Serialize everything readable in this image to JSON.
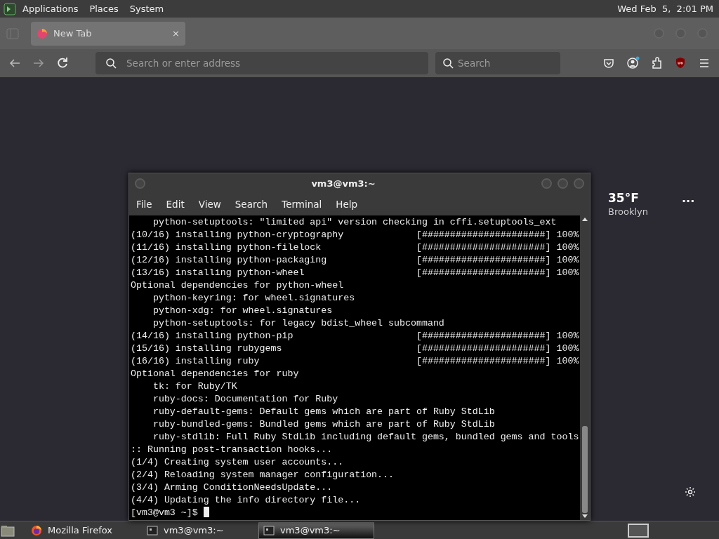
{
  "top_panel": {
    "menus": [
      "Applications",
      "Places",
      "System"
    ],
    "clock": "Wed Feb  5,  2:01 PM"
  },
  "browser": {
    "tabs": [
      {
        "label": "New Tab",
        "close": "×",
        "selected": true
      }
    ],
    "address_bar": {
      "placeholder": "Search or enter address"
    },
    "search_bar": {
      "placeholder": "Search"
    },
    "weather": {
      "temperature": "35°F",
      "city": "Brooklyn",
      "more": "···"
    }
  },
  "terminal": {
    "title": "vm3@vm3:~",
    "menus": [
      "File",
      "Edit",
      "View",
      "Search",
      "Terminal",
      "Help"
    ],
    "lines": [
      "    python-setuptools: \"limited api\" version checking in cffi.setuptools_ext",
      "(10/16) installing python-cryptography             [######################] 100%",
      "(11/16) installing python-filelock                 [######################] 100%",
      "(12/16) installing python-packaging                [######################] 100%",
      "(13/16) installing python-wheel                    [######################] 100%",
      "Optional dependencies for python-wheel",
      "    python-keyring: for wheel.signatures",
      "    python-xdg: for wheel.signatures",
      "    python-setuptools: for legacy bdist_wheel subcommand",
      "(14/16) installing python-pip                      [######################] 100%",
      "(15/16) installing rubygems                        [######################] 100%",
      "(16/16) installing ruby                            [######################] 100%",
      "Optional dependencies for ruby",
      "    tk: for Ruby/TK",
      "    ruby-docs: Documentation for Ruby",
      "    ruby-default-gems: Default gems which are part of Ruby StdLib",
      "    ruby-bundled-gems: Bundled gems which are part of Ruby StdLib",
      "    ruby-stdlib: Full Ruby StdLib including default gems, bundled gems and tools",
      ":: Running post-transaction hooks...",
      "(1/4) Creating system user accounts...",
      "(2/4) Reloading system manager configuration...",
      "(3/4) Arming ConditionNeedsUpdate...",
      "(4/4) Updating the info directory file..."
    ],
    "prompt": "[vm3@vm3 ~]$ "
  },
  "taskbar": {
    "items": [
      {
        "kind": "browser",
        "label": "Mozilla Firefox",
        "selected": false
      },
      {
        "kind": "terminal",
        "label": "vm3@vm3:~",
        "selected": false
      },
      {
        "kind": "terminal",
        "label": "vm3@vm3:~",
        "selected": true
      }
    ]
  }
}
